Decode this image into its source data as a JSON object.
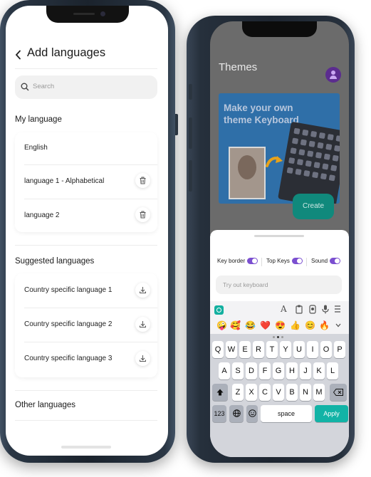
{
  "add_languages": {
    "title": "Add languages",
    "search_placeholder": "Search",
    "my_language_header": "My language",
    "my_languages": [
      {
        "label": "English",
        "icon": "none"
      },
      {
        "label": "language 1 - Alphabetical",
        "icon": "trash-icon"
      },
      {
        "label": "language 2",
        "icon": "trash-icon"
      }
    ],
    "suggested_header": "Suggested languages",
    "suggested_languages": [
      {
        "label": "Country specific language 1",
        "icon": "download-icon"
      },
      {
        "label": "Country specific language 2",
        "icon": "download-icon"
      },
      {
        "label": "Country specific language 3",
        "icon": "download-icon"
      }
    ],
    "other_header": "Other languages"
  },
  "themes": {
    "title": "Themes",
    "banner_text": "Make your own theme Keyboard",
    "create_label": "Create",
    "toggles": [
      {
        "label": "Key border",
        "on": true
      },
      {
        "label": "Top Keys",
        "on": true
      },
      {
        "label": "Sound",
        "on": true
      }
    ],
    "tryout_placeholder": "Try out keyboard",
    "toolbar_icons": [
      "font-icon",
      "clipboard-icon",
      "microphone-icon",
      "menu-icon"
    ],
    "emojis": [
      "🤪",
      "🥰",
      "😂",
      "❤️",
      "😍",
      "👍",
      "😊",
      "🔥"
    ],
    "keyboard": {
      "row1": [
        "Q",
        "W",
        "E",
        "R",
        "T",
        "Y",
        "U",
        "I",
        "O",
        "P"
      ],
      "row2": [
        "A",
        "S",
        "D",
        "F",
        "G",
        "H",
        "J",
        "K",
        "L"
      ],
      "row3": [
        "Z",
        "X",
        "C",
        "V",
        "B",
        "N",
        "M"
      ],
      "numbers_label": "123",
      "space_label": "space",
      "apply_label": "Apply"
    },
    "accent_color": "#7b4fd0",
    "apply_color": "#12b3a6"
  }
}
